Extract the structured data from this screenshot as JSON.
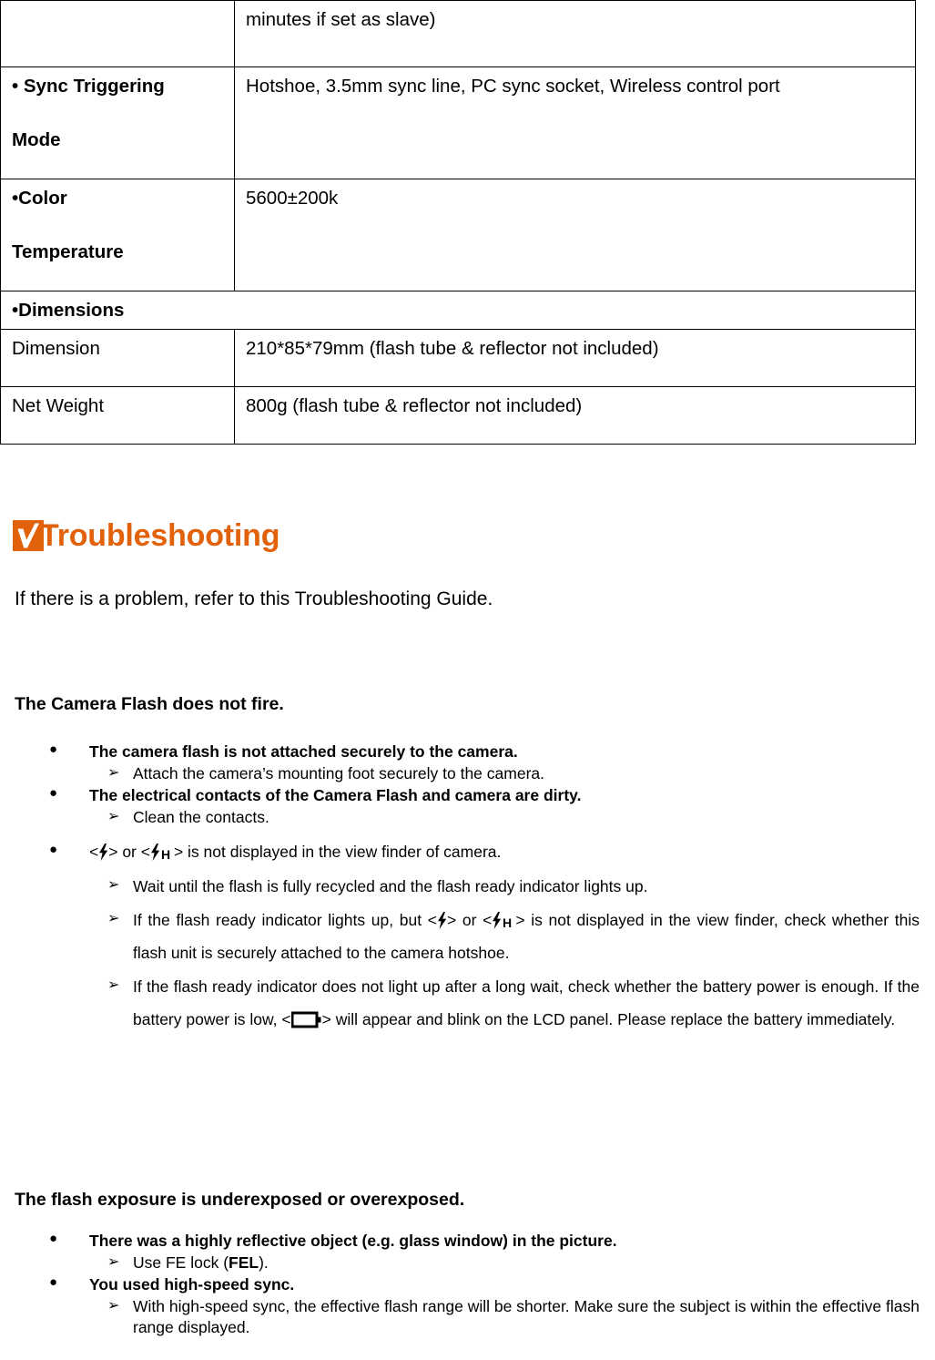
{
  "spec_table": {
    "rows": [
      {
        "type": "pair",
        "label": "",
        "label_bold": false,
        "value": "minutes if set as slave)",
        "height_class": "tall-1"
      },
      {
        "type": "pair",
        "label": "•  Sync Triggering",
        "label_line2": "Mode",
        "label_bold": true,
        "value": "Hotshoe, 3.5mm sync line, PC sync socket, Wireless control port",
        "height_class": "tall-2"
      },
      {
        "type": "pair",
        "label": "•Color",
        "label_line2": "Temperature",
        "label_bold": true,
        "value": "5600±200k",
        "height_class": "tall-2"
      },
      {
        "type": "merged",
        "label": "•Dimensions",
        "label_bold": true
      },
      {
        "type": "pair",
        "label": "Dimension",
        "label_bold": false,
        "value": "210*85*79mm (flash tube & reflector not included)",
        "height_class": "tall-3"
      },
      {
        "type": "pair",
        "label": "Net Weight",
        "label_bold": false,
        "value": "800g (flash tube & reflector not included)",
        "height_class": "tall-3"
      }
    ]
  },
  "troubleshooting": {
    "icon_name": "orange-checkmark-icon",
    "accent_color": "#E2620B",
    "title": "Troubleshooting",
    "intro": "If there is a problem, refer to this Troubleshooting Guide."
  },
  "section_a": {
    "title": "The Camera Flash does not fire.",
    "items": [
      {
        "level": 1,
        "text": "The camera flash is not attached securely to the camera."
      },
      {
        "level": 2,
        "text": "Attach the camera’s mounting foot securely to the camera."
      },
      {
        "level": 1,
        "text": "The electrical contacts of the Camera Flash and camera are dirty."
      },
      {
        "level": 2,
        "text": "Clean the contacts."
      },
      {
        "level": 1,
        "icons": true,
        "text_pre": "<",
        "text_mid": "> or <",
        "text_post": "> is not displayed in the view finder of camera."
      },
      {
        "level": 2,
        "text": "Wait until the flash is fully recycled and the flash ready indicator lights up."
      },
      {
        "level": 2,
        "icons": true,
        "text_pre": "If the flash ready indicator lights up, but <",
        "text_mid": "> or <",
        "text_post": "> is not displayed in the view finder, check whether this flash unit is securely attached to the camera hotshoe."
      },
      {
        "level": 2,
        "icons": true,
        "battery": true,
        "text_pre": "If the flash ready indicator does not light up after a long wait, check whether the battery power is enough. If the battery power is low, <",
        "text_post": "> will appear and blink on the LCD panel. Please replace the battery immediately."
      }
    ]
  },
  "section_b": {
    "title": "The flash exposure is underexposed or overexposed.",
    "items": [
      {
        "level": 1,
        "text": "There was a highly reflective object (e.g. glass window) in the picture."
      },
      {
        "level": 2,
        "bold_token": "FEL",
        "text_pre": "Use FE lock (",
        "text_post": ")."
      },
      {
        "level": 1,
        "text": "You used high-speed sync."
      },
      {
        "level": 2,
        "text": "With high-speed sync, the effective flash range will be shorter. Make sure the subject is within the effective flash range displayed."
      }
    ]
  },
  "icons": {
    "flash": "flash-bolt-icon",
    "flash_h": "flash-bolt-highspeed-icon",
    "battery": "battery-empty-icon"
  }
}
